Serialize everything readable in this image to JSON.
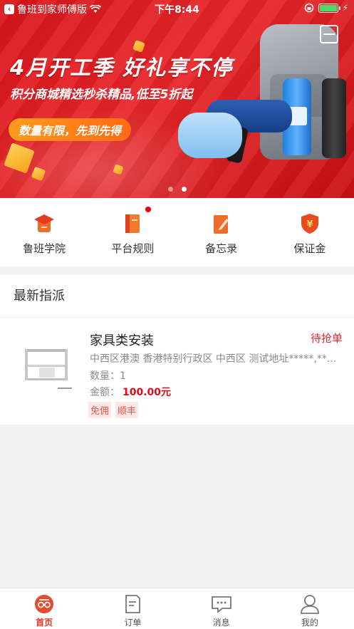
{
  "status_bar": {
    "back_app": "鲁班到家师傅版",
    "time": "下午8:44"
  },
  "banner": {
    "headline": "4月开工季  好礼享不停",
    "subline": "积分商城精选秒杀精品,低至5折起",
    "pill": "数量有限，先到先得",
    "page_count": 2,
    "active_page": 2
  },
  "quick_menu": [
    {
      "label": "鲁班学院",
      "icon": "graduation-cap-icon"
    },
    {
      "label": "平台规则",
      "icon": "rulebook-icon",
      "badge": true
    },
    {
      "label": "备忘录",
      "icon": "memo-pencil-icon"
    },
    {
      "label": "保证金",
      "icon": "deposit-shield-icon"
    }
  ],
  "latest": {
    "title": "最新指派",
    "order": {
      "title": "家具类安装",
      "status": "待抢单",
      "address": "中西区港澳 香港特别行政区 中西区 测试地址*****,**...",
      "quantity": "数量：1",
      "amount_label": "金额：",
      "amount": "100.00元",
      "tags": [
        "免佣",
        "顺丰"
      ]
    }
  },
  "tab_bar": [
    {
      "label": "首页",
      "icon": "home-logo-icon",
      "active": true
    },
    {
      "label": "订单",
      "icon": "order-doc-icon",
      "active": false
    },
    {
      "label": "消息",
      "icon": "message-bubble-icon",
      "active": false
    },
    {
      "label": "我的",
      "icon": "profile-icon",
      "active": false
    }
  ],
  "colors": {
    "brand_red": "#e60012",
    "accent_orange": "#ff6a13",
    "price_red": "#e00a1a"
  }
}
